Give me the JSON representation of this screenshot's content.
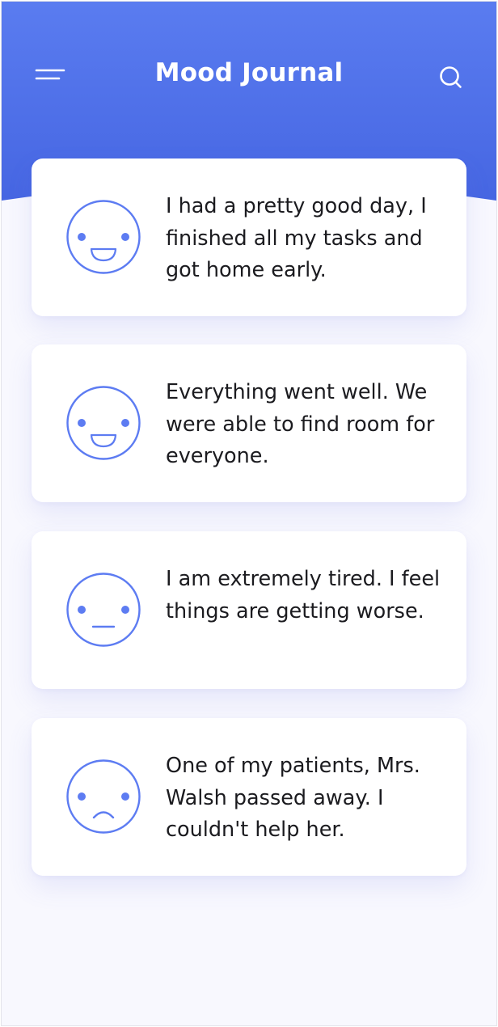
{
  "app": {
    "title": "Mood Journal"
  },
  "colors": {
    "header_top": "#5a7cf0",
    "header_bottom": "#4868e4",
    "accent": "#5d7cf2",
    "background": "#f8f8fe",
    "card": "#ffffff",
    "text": "#1b1b1f"
  },
  "icons": {
    "menu": "menu-icon",
    "search": "search-icon"
  },
  "entries": [
    {
      "mood": "happy",
      "text": "I had a pretty good day, I finished all my tasks and got home early."
    },
    {
      "mood": "happy",
      "text": "Everything went well. We were able to find room for everyone."
    },
    {
      "mood": "neutral",
      "text": "I am extremely tired. I feel things are getting worse."
    },
    {
      "mood": "sad",
      "text": "One of my patients, Mrs. Walsh passed away. I couldn't help her."
    }
  ]
}
